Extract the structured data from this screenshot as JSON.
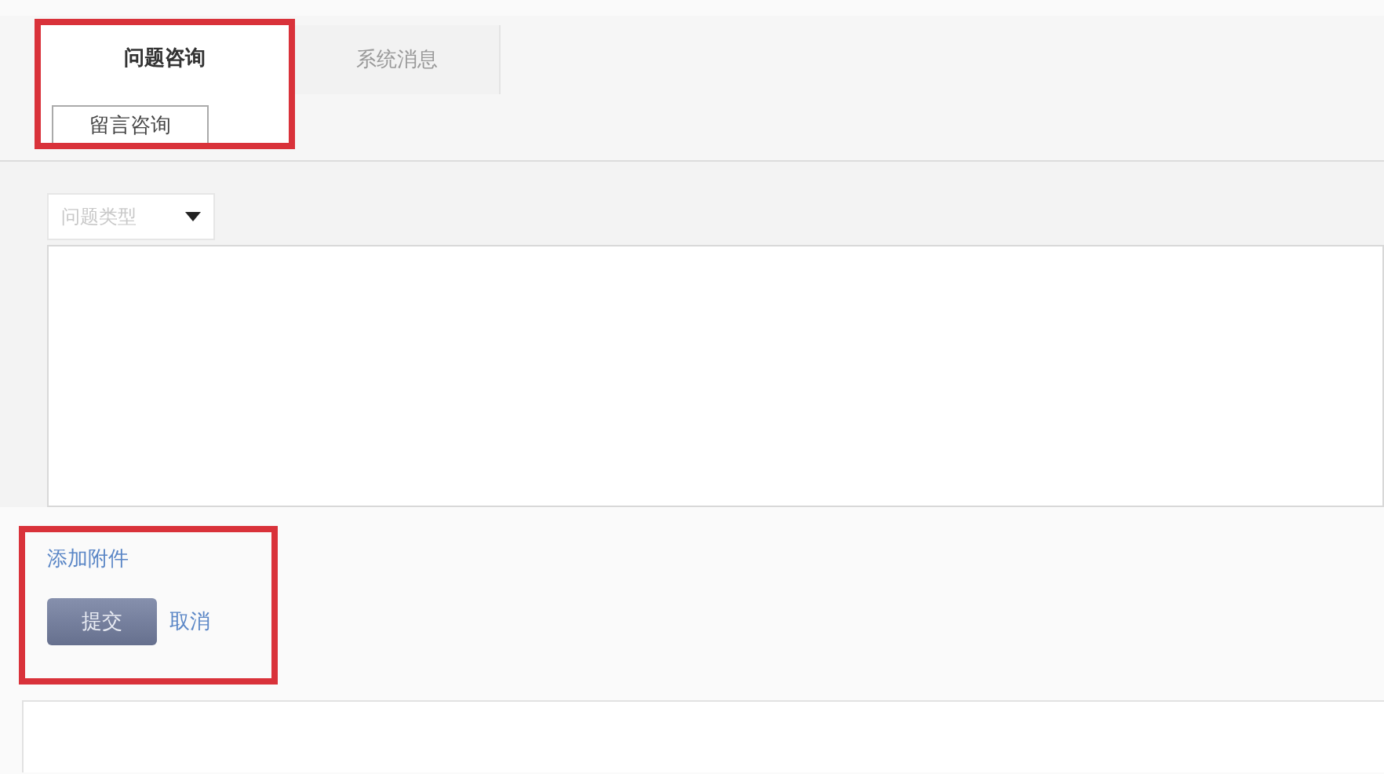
{
  "tabs": [
    {
      "label": "问题咨询",
      "selected": true
    },
    {
      "label": "系统消息",
      "selected": false
    }
  ],
  "subtabs": [
    {
      "label": "留言咨询",
      "selected": true
    }
  ],
  "tabs_highlighted": true,
  "form": {
    "type_select": {
      "placeholder": "问题类型"
    },
    "attach_link": "添加附件",
    "submit": "提交",
    "cancel": "取消",
    "highlighted": true
  }
}
